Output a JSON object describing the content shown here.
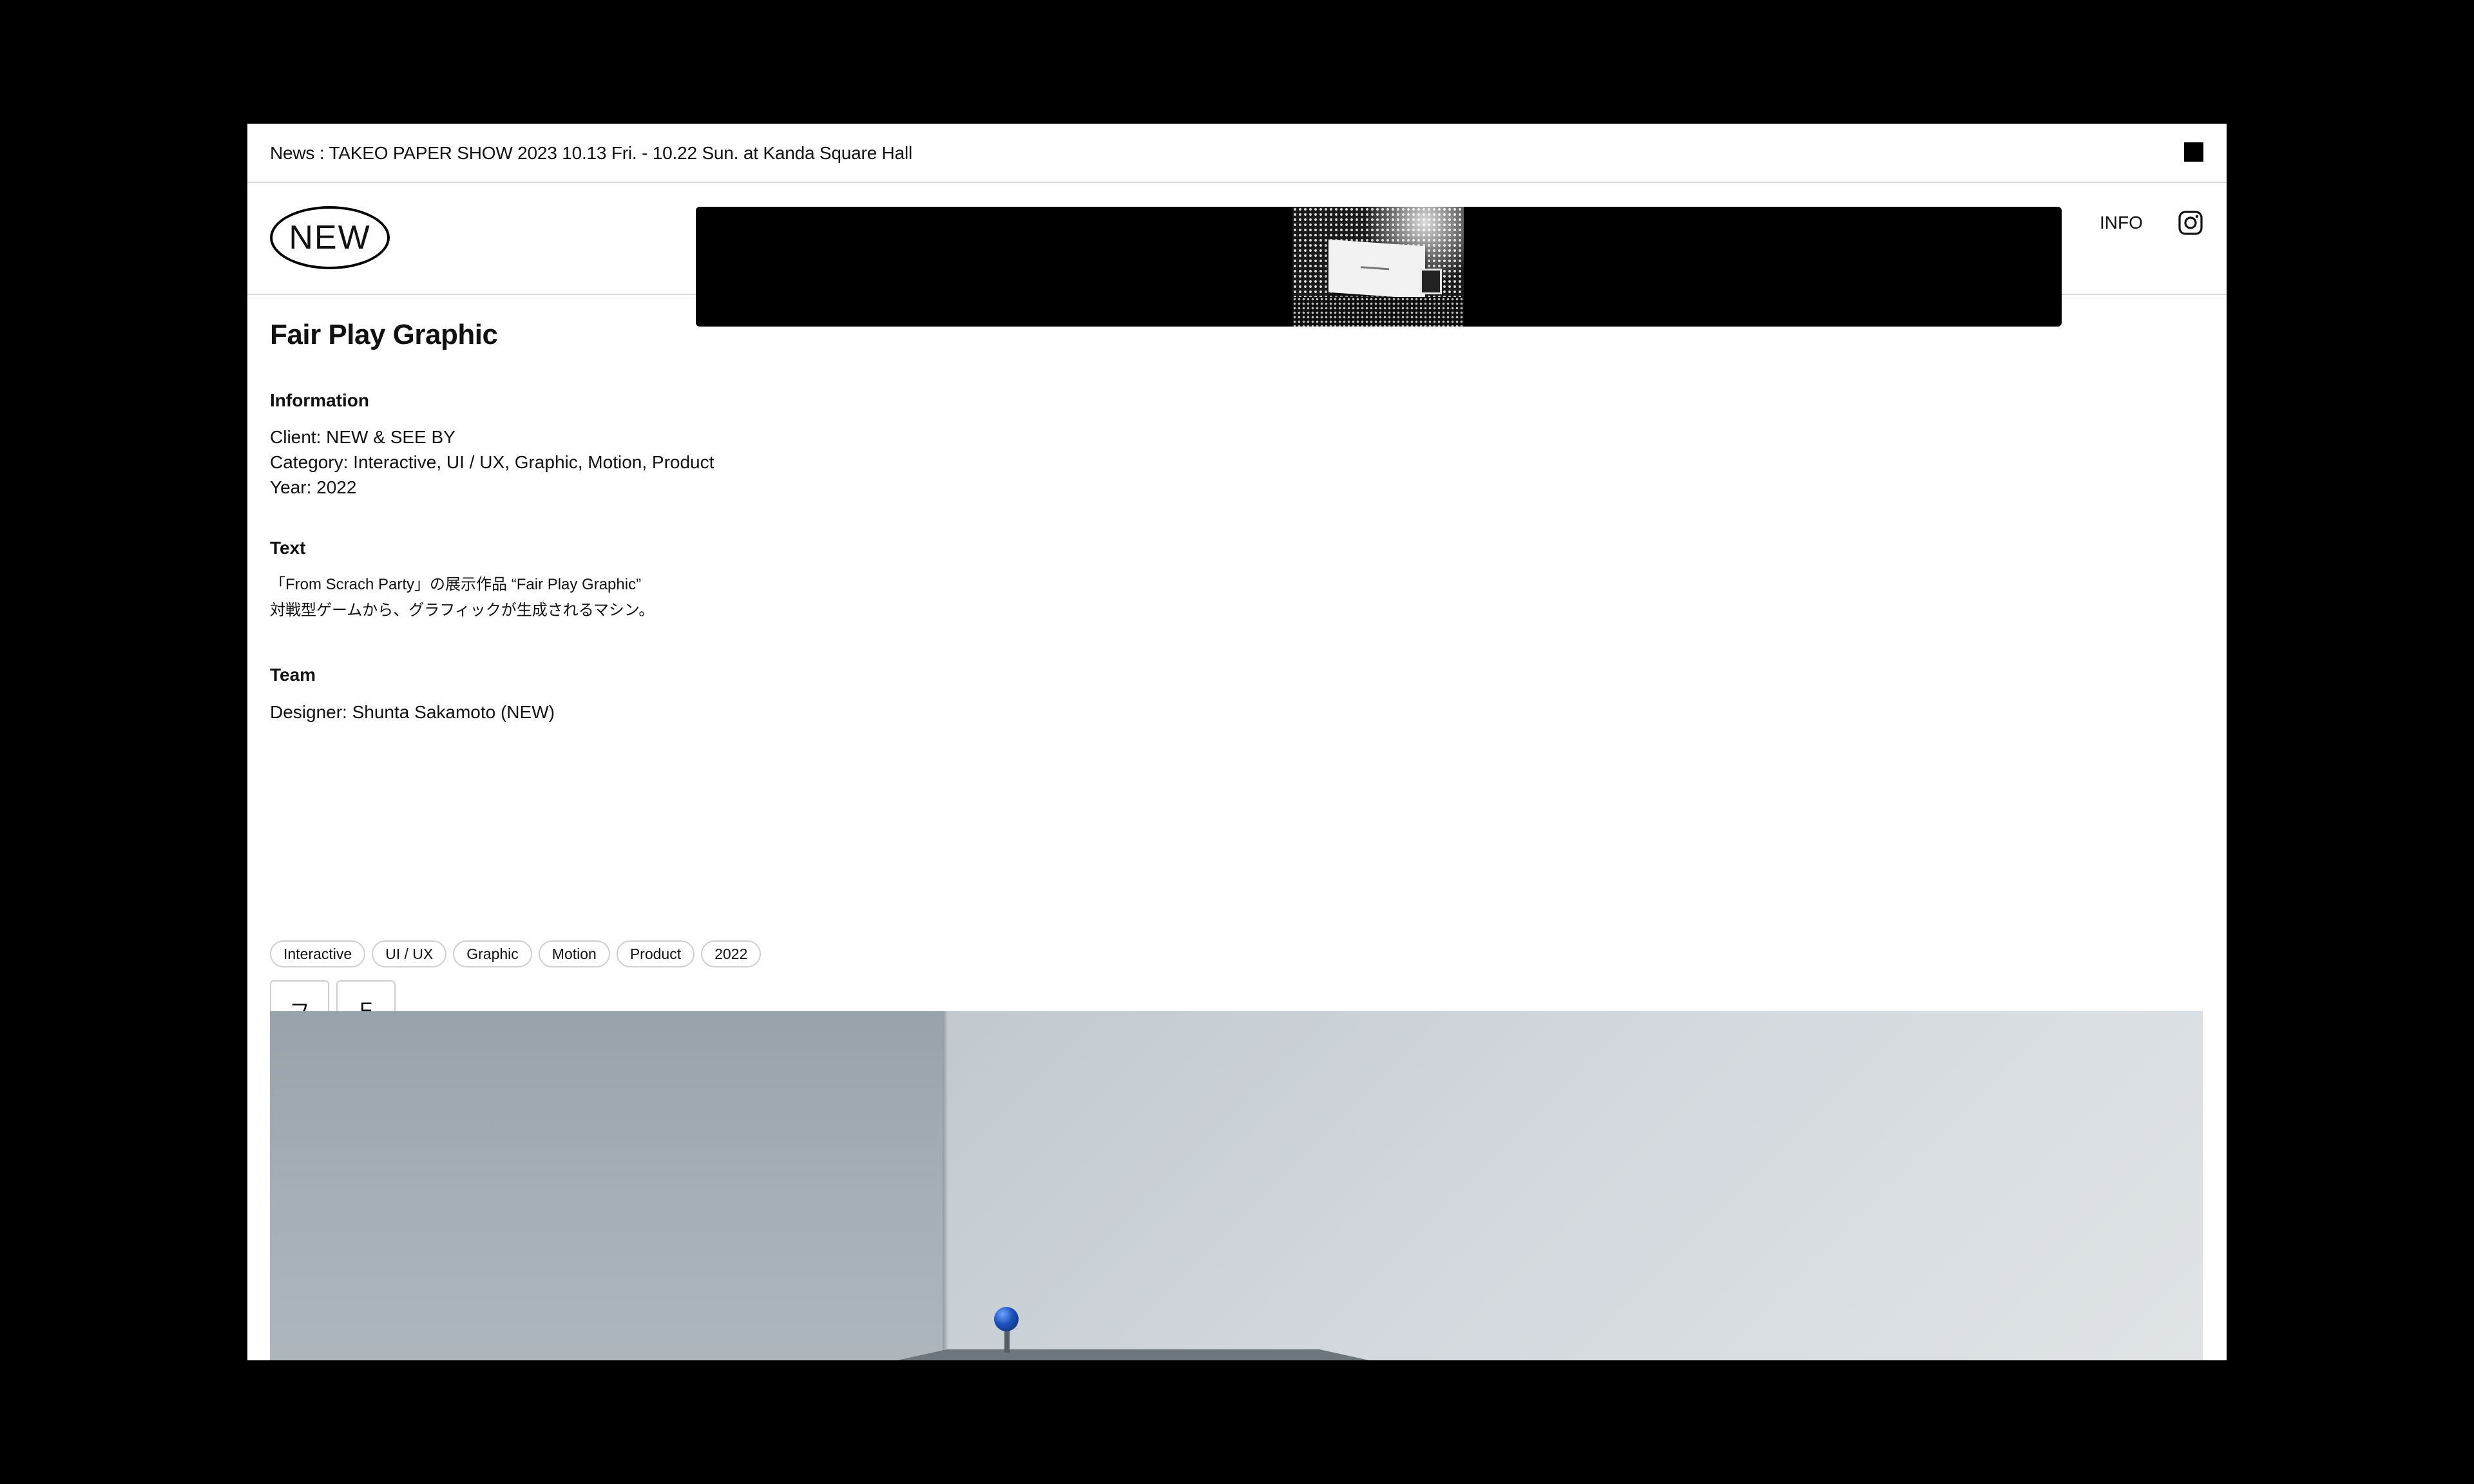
{
  "news": {
    "text": "News : TAKEO PAPER SHOW 2023 10.13 Fri. - 10.22 Sun. at Kanda Square Hall"
  },
  "header": {
    "logo": "NEW",
    "info_link": "INFO"
  },
  "project": {
    "title": "Fair Play Graphic",
    "information": {
      "heading": "Information",
      "client": "Client: NEW & SEE BY",
      "category": "Category: Interactive, UI / UX, Graphic, Motion, Product",
      "year": "Year: 2022"
    },
    "text": {
      "heading": "Text",
      "line1": "「From Scrach Party」の展示作品 “Fair Play Graphic”",
      "line2": "対戦型ゲームから、グラフィックが生成されるマシン。"
    },
    "team": {
      "heading": "Team",
      "designer": "Designer: Shunta Sakamoto (NEW)"
    },
    "tags": [
      "Interactive",
      "UI / UX",
      "Graphic",
      "Motion",
      "Product",
      "2022"
    ],
    "letter_buttons": [
      "フ",
      "F"
    ]
  },
  "icons": {
    "close": "square-close-icon",
    "instagram": "instagram-icon"
  },
  "colors": {
    "background": "#000000",
    "page": "#ffffff",
    "text": "#111111",
    "border": "#cfcfcf"
  }
}
